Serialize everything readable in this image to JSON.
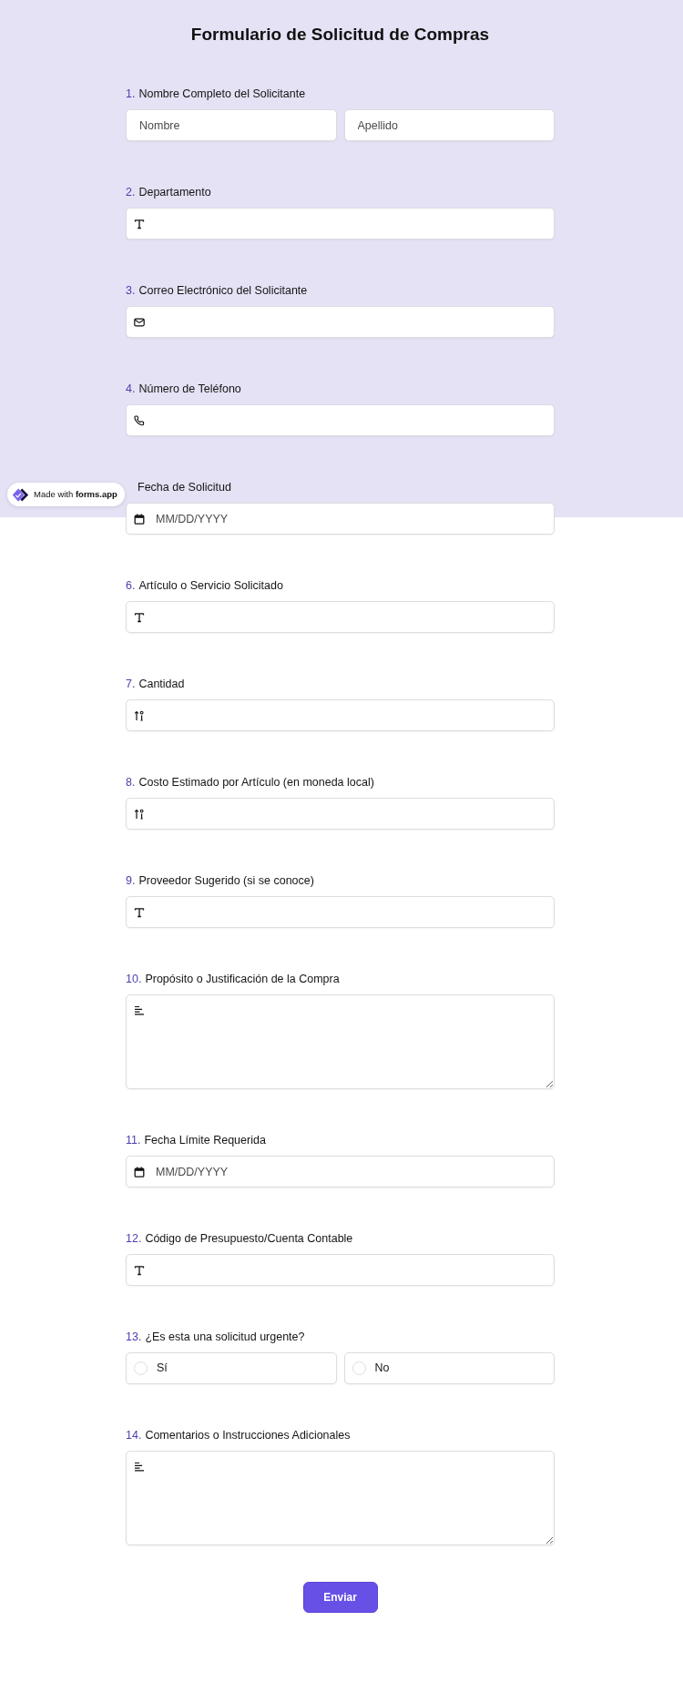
{
  "title": "Formulario de Solicitud de Compras",
  "badge": {
    "text": "Made with **forms.app**"
  },
  "questions": [
    {
      "number": "1.",
      "label": "Nombre Completo del Solicitante",
      "kind": "name",
      "fields": [
        {
          "placeholder": "Nombre"
        },
        {
          "placeholder": "Apellido"
        }
      ]
    },
    {
      "number": "2.",
      "label": "Departamento",
      "kind": "text"
    },
    {
      "number": "3.",
      "label": "Correo Electrónico del Solicitante",
      "kind": "email"
    },
    {
      "number": "4.",
      "label": "Número de Teléfono",
      "kind": "phone"
    },
    {
      "label": "Fecha de Solicitud",
      "kind": "date",
      "placeholder": "MM/DD/YYYY"
    },
    {
      "number": "6.",
      "label": "Artículo o Servicio Solicitado",
      "kind": "text"
    },
    {
      "number": "7.",
      "label": "Cantidad",
      "kind": "number"
    },
    {
      "number": "8.",
      "label": "Costo Estimado por Artículo (en moneda local)",
      "kind": "number"
    },
    {
      "number": "9.",
      "label": "Proveedor Sugerido (si se conoce)",
      "kind": "text"
    },
    {
      "number": "10.",
      "label": "Propósito o Justificación de la Compra",
      "kind": "paragraph"
    },
    {
      "number": "11.",
      "label": "Fecha Límite Requerida",
      "kind": "date",
      "placeholder": "MM/DD/YYYY"
    },
    {
      "number": "12.",
      "label": "Código de Presupuesto/Cuenta Contable",
      "kind": "text"
    },
    {
      "number": "13.",
      "label": "¿Es esta una solicitud urgente?",
      "kind": "choice",
      "options": [
        {
          "label": "Sí",
          "selected": false
        },
        {
          "label": "No",
          "selected": false
        }
      ]
    },
    {
      "number": "14.",
      "label": "Comentarios o Instrucciones Adicionales",
      "kind": "paragraph"
    }
  ],
  "submit": {
    "label": "Enviar"
  }
}
